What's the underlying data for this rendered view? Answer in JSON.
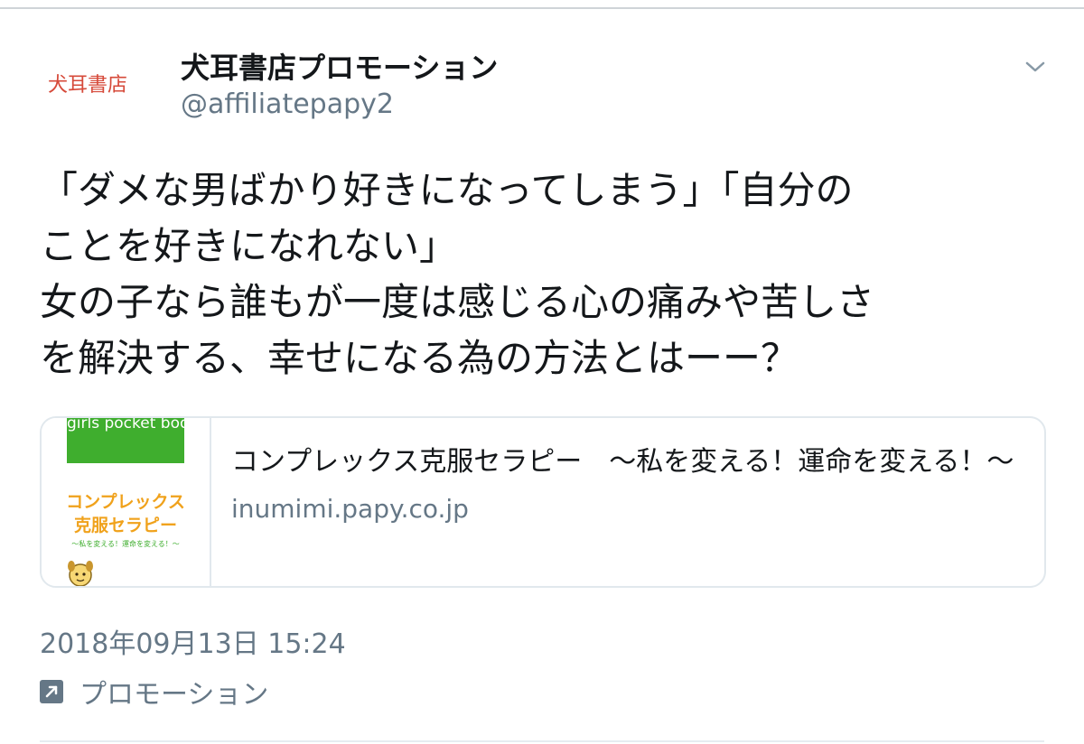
{
  "account": {
    "avatar_text": "犬耳書店",
    "display_name": "犬耳書店プロモーション",
    "handle": "@affiliatepapy2",
    "menu_icon": "chevron-down-icon"
  },
  "tweet": {
    "lines": [
      "「ダメな男ばかり好きになってしまう」「自分の",
      "ことを好きになれない」",
      "女の子なら誰もが一度は感じる心の痛みや苦しさ",
      "を解決する、幸せになる為の方法とはーー？"
    ]
  },
  "card": {
    "thumbnail": {
      "banner_text": "girls pocket book",
      "title_line1": "コンプレックス",
      "title_line2": "克服セラピー",
      "subtitle": "〜私を変える！運命を変える！〜",
      "mascot_icon": "mascot-icon"
    },
    "title": "コンプレックス克服セラピー　〜私を変える！運命を変える！〜",
    "domain": "inumimi.papy.co.jp"
  },
  "meta": {
    "timestamp": "2018年09月13日 15:24",
    "promoted_label": "プロモーション",
    "promoted_icon": "promoted-arrow-icon"
  },
  "colors": {
    "text_primary": "#14171a",
    "text_secondary": "#657786",
    "brand_red": "#d64a3a",
    "card_border": "#e1e8ed",
    "thumb_green": "#3fae2e",
    "thumb_orange": "#f0a21c"
  }
}
